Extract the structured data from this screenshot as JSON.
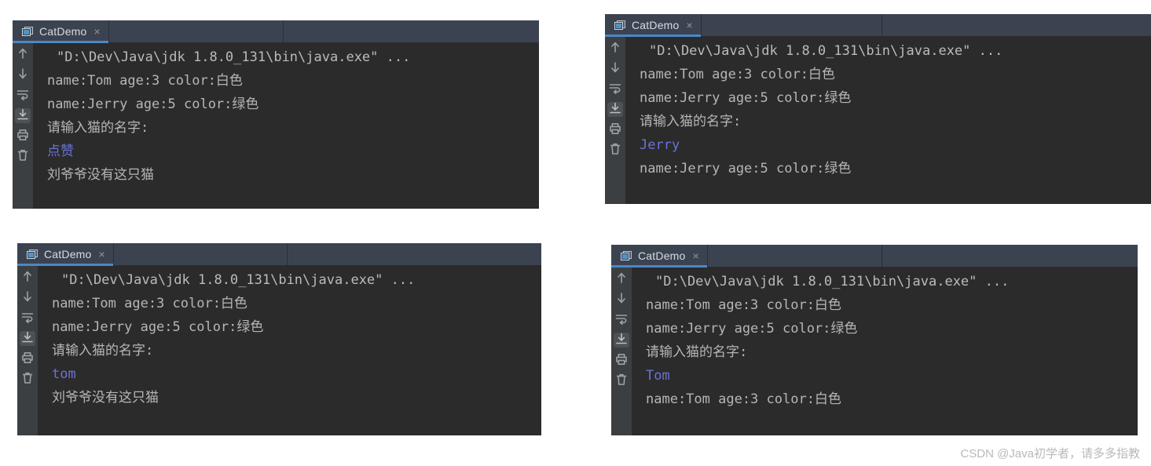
{
  "app": {
    "tab_label": "CatDemo",
    "close_glyph": "×",
    "accent_color": "#4a88c7",
    "console_bg": "#2b2b2b",
    "panel_bg": "#3c3f41",
    "tabbar_bg": "#3c4350",
    "output_color": "#b6b6b6",
    "input_color": "#6a73d6"
  },
  "gutter": {
    "icons": [
      {
        "name": "scroll-up-icon",
        "glyph": "up-arrow",
        "selected": false
      },
      {
        "name": "scroll-down-icon",
        "glyph": "down-arrow",
        "selected": false
      },
      {
        "name": "soft-wrap-icon",
        "glyph": "wrap",
        "selected": false
      },
      {
        "name": "scroll-to-end-icon",
        "glyph": "scroll-end",
        "selected": true
      },
      {
        "name": "print-icon",
        "glyph": "printer",
        "selected": false
      },
      {
        "name": "clear-all-icon",
        "glyph": "trash",
        "selected": false
      }
    ]
  },
  "panels": [
    {
      "id": "panel-top-left",
      "tab": "CatDemo",
      "lines": [
        {
          "text": "\"D:\\Dev\\Java\\jdk 1.8.0_131\\bin\\java.exe\" ...",
          "kind": "sys",
          "indent": true
        },
        {
          "text": "name:Tom age:3 color:白色",
          "kind": "out",
          "indent": false
        },
        {
          "text": "name:Jerry age:5 color:绿色",
          "kind": "out",
          "indent": false
        },
        {
          "text": "请输入猫的名字:",
          "kind": "out",
          "indent": false
        },
        {
          "text": "点赞",
          "kind": "in",
          "indent": false
        },
        {
          "text": "刘爷爷没有这只猫",
          "kind": "out",
          "indent": false
        }
      ]
    },
    {
      "id": "panel-top-right",
      "tab": "CatDemo",
      "lines": [
        {
          "text": "\"D:\\Dev\\Java\\jdk 1.8.0_131\\bin\\java.exe\" ...",
          "kind": "sys",
          "indent": true
        },
        {
          "text": "name:Tom age:3 color:白色",
          "kind": "out",
          "indent": false
        },
        {
          "text": "name:Jerry age:5 color:绿色",
          "kind": "out",
          "indent": false
        },
        {
          "text": "请输入猫的名字:",
          "kind": "out",
          "indent": false
        },
        {
          "text": "Jerry",
          "kind": "in",
          "indent": false
        },
        {
          "text": "name:Jerry age:5 color:绿色",
          "kind": "out",
          "indent": false
        }
      ]
    },
    {
      "id": "panel-bottom-left",
      "tab": "CatDemo",
      "lines": [
        {
          "text": "\"D:\\Dev\\Java\\jdk 1.8.0_131\\bin\\java.exe\" ...",
          "kind": "sys",
          "indent": true
        },
        {
          "text": "name:Tom age:3 color:白色",
          "kind": "out",
          "indent": false
        },
        {
          "text": "name:Jerry age:5 color:绿色",
          "kind": "out",
          "indent": false
        },
        {
          "text": "请输入猫的名字:",
          "kind": "out",
          "indent": false
        },
        {
          "text": "tom",
          "kind": "in",
          "indent": false
        },
        {
          "text": "刘爷爷没有这只猫",
          "kind": "out",
          "indent": false
        }
      ]
    },
    {
      "id": "panel-bottom-right",
      "tab": "CatDemo",
      "lines": [
        {
          "text": "\"D:\\Dev\\Java\\jdk 1.8.0_131\\bin\\java.exe\" ...",
          "kind": "sys",
          "indent": true
        },
        {
          "text": "name:Tom age:3 color:白色",
          "kind": "out",
          "indent": false
        },
        {
          "text": "name:Jerry age:5 color:绿色",
          "kind": "out",
          "indent": false
        },
        {
          "text": "请输入猫的名字:",
          "kind": "out",
          "indent": false
        },
        {
          "text": "Tom",
          "kind": "in",
          "indent": false
        },
        {
          "text": "name:Tom age:3 color:白色",
          "kind": "out",
          "indent": false
        }
      ]
    }
  ],
  "watermark": "CSDN @Java初学者，请多多指教"
}
